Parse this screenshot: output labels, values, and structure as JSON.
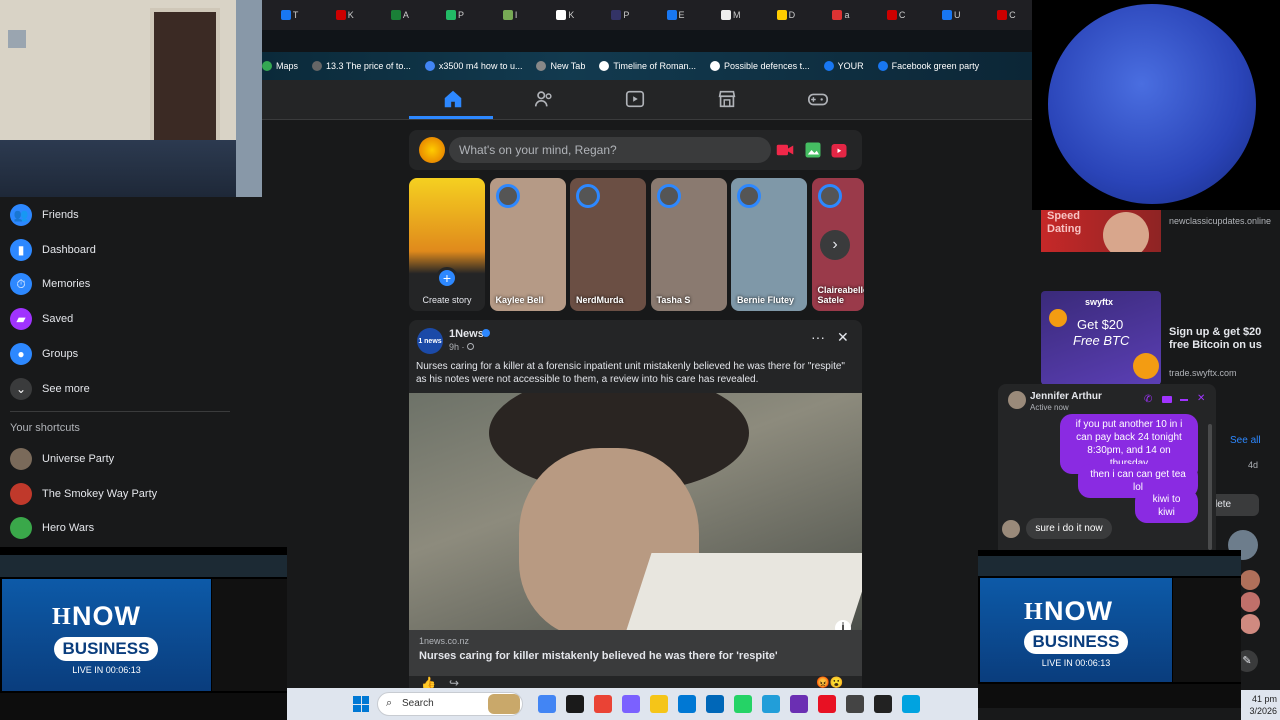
{
  "browser": {
    "tabs": [
      "T",
      "K",
      "A",
      "P",
      "I",
      "K",
      "P",
      "E",
      "M",
      "D",
      "a",
      "C",
      "U",
      "C"
    ],
    "bookmarks": [
      {
        "label": "Maps",
        "color": "#34a853"
      },
      {
        "label": "13.3 The price of to...",
        "color": "#666666"
      },
      {
        "label": "x3500 m4 how to u...",
        "color": "#4285f4"
      },
      {
        "label": "New Tab",
        "color": "#888888"
      },
      {
        "label": "Timeline of Roman...",
        "color": "#ffffff"
      },
      {
        "label": "Possible defences t...",
        "color": "#ffffff"
      },
      {
        "label": "YOUR",
        "color": "#1877f2"
      },
      {
        "label": "Facebook green party",
        "color": "#1877f2"
      }
    ]
  },
  "fb": {
    "sidebar": [
      {
        "label": "Friends",
        "icon": "friends-icon",
        "color": "#2d88ff"
      },
      {
        "label": "Dashboard",
        "icon": "dashboard-icon",
        "color": "#2d88ff"
      },
      {
        "label": "Memories",
        "icon": "memories-icon",
        "color": "#2d88ff"
      },
      {
        "label": "Saved",
        "icon": "saved-icon",
        "color": "#a033ff"
      },
      {
        "label": "Groups",
        "icon": "groups-icon",
        "color": "#2d88ff"
      },
      {
        "label": "See more",
        "icon": "chevron-down-icon",
        "color": "#3a3b3c"
      }
    ],
    "shortcuts_heading": "Your shortcuts",
    "shortcuts": [
      {
        "label": "Universe Party",
        "color": "#7a6a5a"
      },
      {
        "label": "The Smokey Way Party",
        "color": "#c0392b"
      },
      {
        "label": "Hero Wars",
        "color": "#3aa84a"
      }
    ],
    "composer_placeholder": "What's on your mind, Regan?",
    "stories": [
      {
        "name": "Create story",
        "bg": "#c9a227"
      },
      {
        "name": "Kaylee Bell",
        "bg": "#b59a86"
      },
      {
        "name": "NerdMurda",
        "bg": "#6b4f44"
      },
      {
        "name": "Tasha S",
        "bg": "#8a7a70"
      },
      {
        "name": "Bernie Flutey",
        "bg": "#7f98a8"
      },
      {
        "name": "Claireabelle Satele",
        "bg": "#9a3a4a"
      }
    ],
    "post": {
      "author": "1News",
      "time": "9h ·",
      "text": "Nurses caring for a killer at a forensic inpatient unit mistakenly believed he was there for \"respite\" as his notes were not accessible to them, a review into his care has revealed.",
      "link_domain": "1news.co.nz",
      "link_title": "Nurses caring for killer mistakenly believed he was there for 'respite'",
      "avatar_text": "1 news"
    },
    "ads": [
      {
        "title": "",
        "url": "newclassicupdates.online",
        "image_text": "Speed Dating"
      },
      {
        "title": "Sign up & get $20 free Bitcoin on us",
        "url": "trade.swyftx.com",
        "image_brand": "swyftx",
        "image_text1": "Get $20",
        "image_text2": "Free BTC"
      }
    ],
    "see_all": "See all",
    "time_4d": "4d",
    "delete_partial": "lete"
  },
  "chat": {
    "name": "Jennifer Arthur",
    "status": "Active now",
    "messages": [
      {
        "from": "me",
        "text": "if you put another 10 in i can pay back 24 tonight 8:30pm, and 14 on thursday"
      },
      {
        "from": "me",
        "text": "then i can can get tea lol"
      },
      {
        "from": "me",
        "text": "kiwi to kiwi"
      },
      {
        "from": "them",
        "text": "sure i do it now"
      }
    ]
  },
  "now_overlay": {
    "logo": "NOW",
    "sub": "BUSINESS",
    "live": "LIVE IN 00:06:13"
  },
  "taskbar": {
    "search_label": "Search",
    "clock_time": "41 pm",
    "clock_date": "3/2026"
  }
}
